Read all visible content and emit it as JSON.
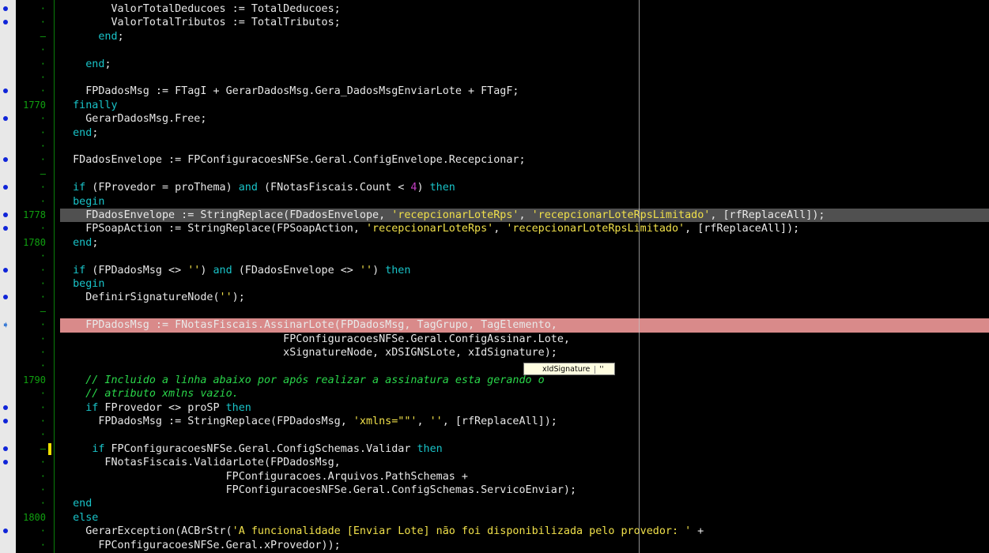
{
  "colors": {
    "background": "#000000",
    "keyword": "#19c3c8",
    "string": "#f0e04a",
    "comment": "#2ad64a",
    "number": "#c440c4",
    "line_number": "#10a010",
    "breakpoint": "#0f24d8",
    "current_line": "#505050",
    "error_line": "#d98a8a",
    "change_marker": "#f0e000"
  },
  "hint": {
    "name": "xIdSignature",
    "value": "''"
  },
  "lines": [
    {
      "ln": "",
      "fold": "·",
      "bp": true,
      "segs": [
        {
          "t": "        ValorTotalDeducoes := TotalDeducoes;"
        }
      ]
    },
    {
      "ln": "",
      "fold": "·",
      "bp": true,
      "segs": [
        {
          "t": "        ValorTotalTributos := TotalTributos;"
        }
      ]
    },
    {
      "ln": "",
      "fold": "–",
      "segs": [
        {
          "t": "      "
        },
        {
          "t": "end",
          "c": "k"
        },
        {
          "t": ";"
        }
      ]
    },
    {
      "ln": "",
      "fold": "·",
      "segs": []
    },
    {
      "ln": "",
      "fold": "·",
      "segs": [
        {
          "t": "    "
        },
        {
          "t": "end",
          "c": "k"
        },
        {
          "t": ";"
        }
      ]
    },
    {
      "ln": "",
      "fold": "·",
      "segs": []
    },
    {
      "ln": "",
      "fold": "·",
      "bp": true,
      "segs": [
        {
          "t": "    FPDadosMsg := FTagI + GerarDadosMsg.Gera_DadosMsgEnviarLote + FTagF;"
        }
      ]
    },
    {
      "ln": "1770",
      "fold": "",
      "segs": [
        {
          "t": "  "
        },
        {
          "t": "finally",
          "c": "k"
        }
      ]
    },
    {
      "ln": "",
      "fold": "·",
      "bp": true,
      "segs": [
        {
          "t": "    GerarDadosMsg.Free;"
        }
      ]
    },
    {
      "ln": "",
      "fold": "·",
      "segs": [
        {
          "t": "  "
        },
        {
          "t": "end",
          "c": "k"
        },
        {
          "t": ";"
        }
      ]
    },
    {
      "ln": "",
      "fold": "·",
      "segs": []
    },
    {
      "ln": "",
      "fold": "·",
      "bp": true,
      "segs": [
        {
          "t": "  FDadosEnvelope := FPConfiguracoesNFSe.Geral.ConfigEnvelope.Recepcionar;"
        }
      ]
    },
    {
      "ln": "",
      "fold": "–",
      "segs": []
    },
    {
      "ln": "",
      "fold": "·",
      "bp": true,
      "segs": [
        {
          "t": "  "
        },
        {
          "t": "if",
          "c": "k"
        },
        {
          "t": " (FProvedor = proThema) "
        },
        {
          "t": "and",
          "c": "k"
        },
        {
          "t": " (FNotasFiscais.Count < "
        },
        {
          "t": "4",
          "c": "n"
        },
        {
          "t": ") "
        },
        {
          "t": "then",
          "c": "k"
        }
      ]
    },
    {
      "ln": "",
      "fold": "·",
      "segs": [
        {
          "t": "  "
        },
        {
          "t": "begin",
          "c": "k"
        }
      ]
    },
    {
      "ln": "1778",
      "fold": "",
      "bp": true,
      "hl": "current",
      "segs": [
        {
          "t": "    FDadosEnvelope := StringReplace(FDadosEnvelope, "
        },
        {
          "t": "'recepcionarLoteRps'",
          "c": "s"
        },
        {
          "t": ", "
        },
        {
          "t": "'recepcionarLoteRpsLimitado'",
          "c": "s"
        },
        {
          "t": ", [rfReplaceAll]);"
        }
      ]
    },
    {
      "ln": "",
      "fold": "·",
      "bp": true,
      "segs": [
        {
          "t": "    FPSoapAction := StringReplace(FPSoapAction, "
        },
        {
          "t": "'recepcionarLoteRps'",
          "c": "s"
        },
        {
          "t": ", "
        },
        {
          "t": "'recepcionarLoteRpsLimitado'",
          "c": "s"
        },
        {
          "t": ", [rfReplaceAll]);"
        }
      ]
    },
    {
      "ln": "1780",
      "fold": "",
      "segs": [
        {
          "t": "  "
        },
        {
          "t": "end",
          "c": "k"
        },
        {
          "t": ";"
        }
      ]
    },
    {
      "ln": "",
      "fold": "·",
      "segs": []
    },
    {
      "ln": "",
      "fold": "·",
      "bp": true,
      "segs": [
        {
          "t": "  "
        },
        {
          "t": "if",
          "c": "k"
        },
        {
          "t": " (FPDadosMsg <> "
        },
        {
          "t": "''",
          "c": "s"
        },
        {
          "t": ") "
        },
        {
          "t": "and",
          "c": "k"
        },
        {
          "t": " (FDadosEnvelope <> "
        },
        {
          "t": "''",
          "c": "s"
        },
        {
          "t": ") "
        },
        {
          "t": "then",
          "c": "k"
        }
      ]
    },
    {
      "ln": "",
      "fold": "·",
      "segs": [
        {
          "t": "  "
        },
        {
          "t": "begin",
          "c": "k"
        }
      ]
    },
    {
      "ln": "",
      "fold": "·",
      "bp": true,
      "segs": [
        {
          "t": "    DefinirSignatureNode("
        },
        {
          "t": "''",
          "c": "s"
        },
        {
          "t": ");"
        }
      ]
    },
    {
      "ln": "",
      "fold": "–",
      "segs": []
    },
    {
      "ln": "",
      "fold": "·",
      "exec": true,
      "hl": "error",
      "segs": [
        {
          "t": "    FPDadosMsg := FNotasFiscais.AssinarLote(FPDadosMsg, TagGrupo, TagElemento,"
        }
      ]
    },
    {
      "ln": "",
      "fold": "·",
      "segs": [
        {
          "t": "                                   FPConfiguracoesNFSe.Geral.ConfigAssinar.Lote,"
        }
      ]
    },
    {
      "ln": "",
      "fold": "·",
      "segs": [
        {
          "t": "                                   xSignatureNode, xDSIGNSLote, xIdSignature);"
        }
      ]
    },
    {
      "ln": "",
      "fold": "·",
      "segs": []
    },
    {
      "ln": "1790",
      "fold": "",
      "segs": [
        {
          "t": "    "
        },
        {
          "t": "// Incluido a linha abaixo por após realizar a assinatura esta gerando o",
          "c": "c"
        }
      ]
    },
    {
      "ln": "",
      "fold": "·",
      "segs": [
        {
          "t": "    "
        },
        {
          "t": "// atributo xmlns vazio.",
          "c": "c"
        }
      ]
    },
    {
      "ln": "",
      "fold": "·",
      "bp": true,
      "segs": [
        {
          "t": "    "
        },
        {
          "t": "if",
          "c": "k"
        },
        {
          "t": " FProvedor <> proSP "
        },
        {
          "t": "then",
          "c": "k"
        }
      ]
    },
    {
      "ln": "",
      "fold": "·",
      "bp": true,
      "segs": [
        {
          "t": "      FPDadosMsg := StringReplace(FPDadosMsg, "
        },
        {
          "t": "'xmlns=\"\"'",
          "c": "s"
        },
        {
          "t": ", "
        },
        {
          "t": "''",
          "c": "s"
        },
        {
          "t": ", [rfReplaceAll]);"
        }
      ]
    },
    {
      "ln": "",
      "fold": "·",
      "segs": []
    },
    {
      "ln": "",
      "fold": "–",
      "bp": true,
      "chg": true,
      "segs": [
        {
          "t": "     "
        },
        {
          "t": "if",
          "c": "k"
        },
        {
          "t": " FPConfiguracoesNFSe.Geral.ConfigSchemas.Validar "
        },
        {
          "t": "then",
          "c": "k"
        }
      ]
    },
    {
      "ln": "",
      "fold": "·",
      "bp": true,
      "segs": [
        {
          "t": "       FNotasFiscais.ValidarLote(FPDadosMsg,"
        }
      ]
    },
    {
      "ln": "",
      "fold": "·",
      "segs": [
        {
          "t": "                          FPConfiguracoes.Arquivos.PathSchemas +"
        }
      ]
    },
    {
      "ln": "",
      "fold": "·",
      "segs": [
        {
          "t": "                          FPConfiguracoesNFSe.Geral.ConfigSchemas.ServicoEnviar);"
        }
      ]
    },
    {
      "ln": "",
      "fold": "·",
      "segs": [
        {
          "t": "  "
        },
        {
          "t": "end",
          "c": "k"
        }
      ]
    },
    {
      "ln": "1800",
      "fold": "",
      "segs": [
        {
          "t": "  "
        },
        {
          "t": "else",
          "c": "k"
        }
      ]
    },
    {
      "ln": "",
      "fold": "·",
      "bp": true,
      "segs": [
        {
          "t": "    GerarException(ACBrStr("
        },
        {
          "t": "'A funcionalidade [Enviar Lote] não foi disponibilizada pelo provedor: '",
          "c": "s"
        },
        {
          "t": " +"
        }
      ]
    },
    {
      "ln": "",
      "fold": "·",
      "segs": [
        {
          "t": "      FPConfiguracoesNFSe.Geral.xProvedor));"
        }
      ]
    }
  ]
}
